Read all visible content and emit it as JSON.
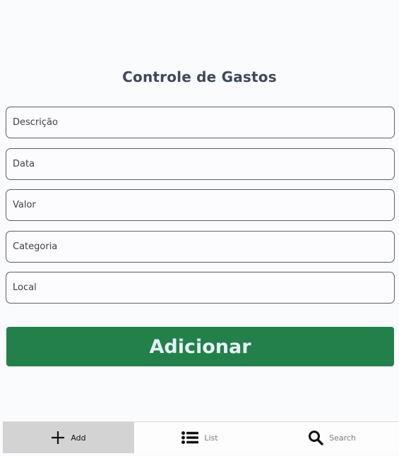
{
  "header": {
    "title": "Controle de Gastos"
  },
  "form": {
    "fields": [
      {
        "placeholder": "Descrição",
        "value": ""
      },
      {
        "placeholder": "Data",
        "value": ""
      },
      {
        "placeholder": "Valor",
        "value": ""
      },
      {
        "placeholder": "Categoria",
        "value": ""
      },
      {
        "placeholder": "Local",
        "value": ""
      }
    ],
    "submit_label": "Adicionar"
  },
  "tabbar": {
    "tabs": [
      {
        "label": "Add",
        "icon": "plus-icon",
        "active": true
      },
      {
        "label": "List",
        "icon": "list-icon",
        "active": false
      },
      {
        "label": "Search",
        "icon": "search-icon",
        "active": false
      }
    ]
  },
  "colors": {
    "accent": "#23804a",
    "title": "#3d4a5c",
    "active_tab": "#d3d3d3"
  }
}
